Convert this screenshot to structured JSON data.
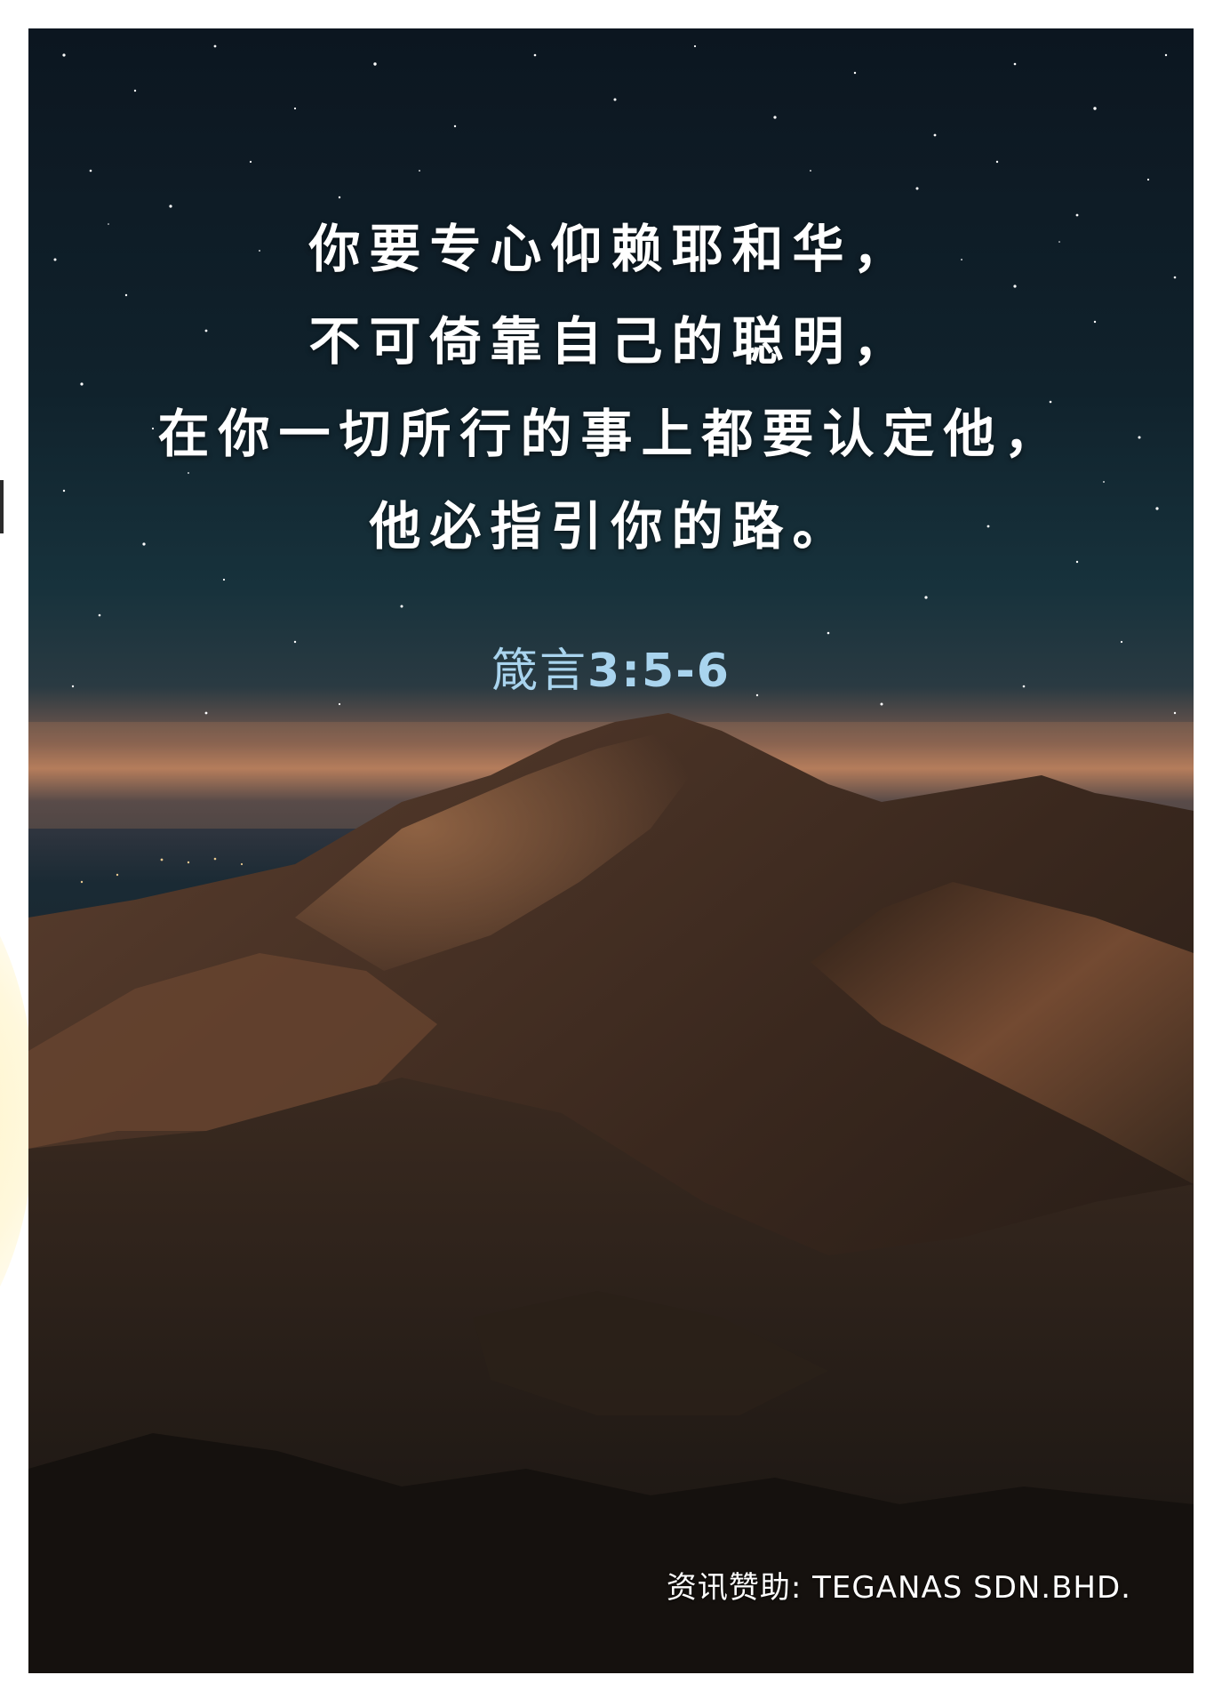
{
  "verse": {
    "lines": [
      "你要专心仰赖耶和华，",
      "不可倚靠自己的聪明，",
      "在你一切所行的事上都要认定他，",
      "他必指引你的路。"
    ]
  },
  "reference": {
    "book": "箴言",
    "chapter_verse": "3:5-6"
  },
  "sponsor": {
    "text": "资讯赞助: TEGANAS SDN.BHD."
  },
  "colors": {
    "sky_top": "#0d1a24",
    "sky_horizon": "#1d3a46",
    "sunset_glow": "#c98a5a",
    "mountain_dark": "#1a1410",
    "mountain_lit": "#8a5a3a",
    "reference_text": "#a9d4ee",
    "verse_text": "#ffffff"
  }
}
